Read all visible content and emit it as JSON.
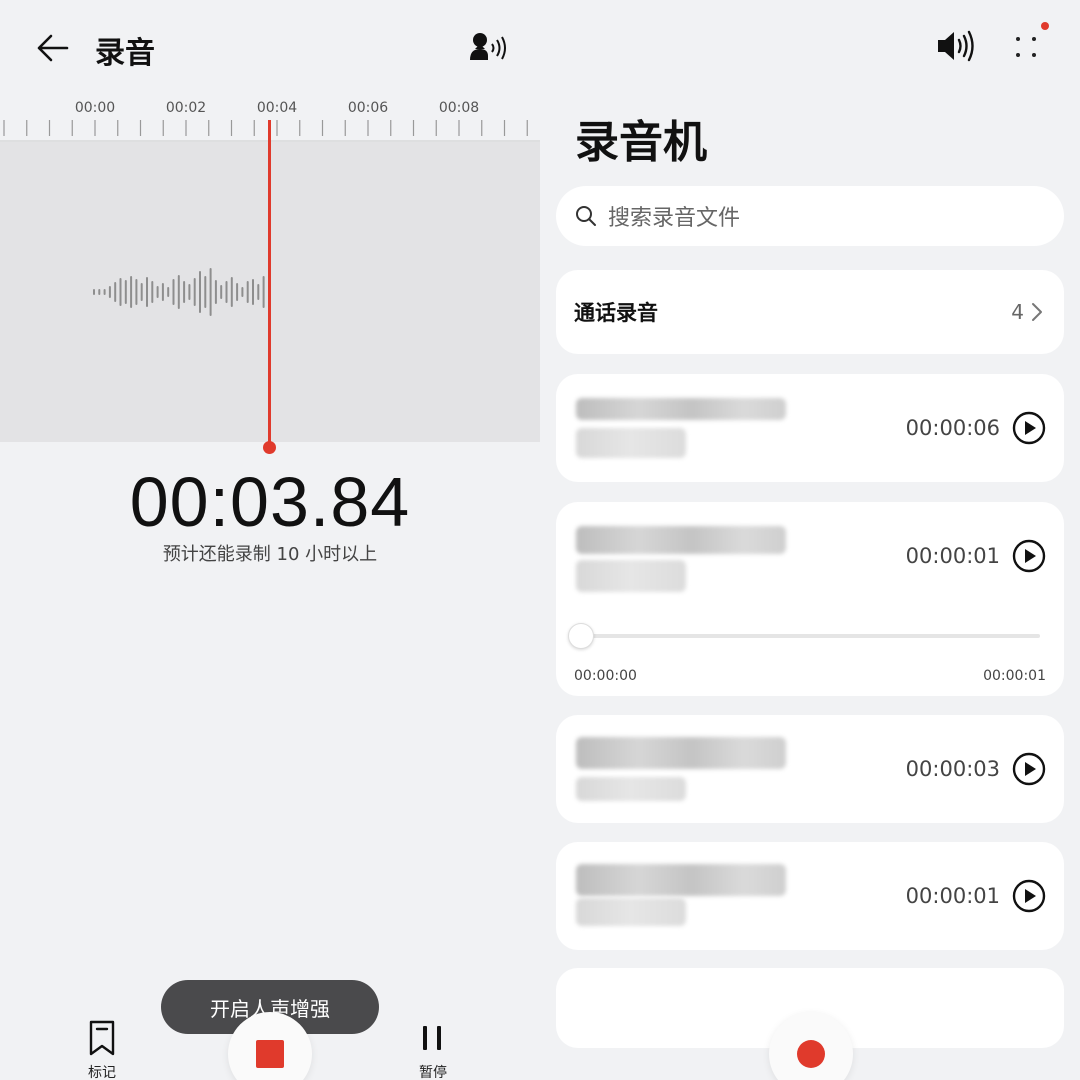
{
  "recorder": {
    "title": "录音",
    "ruler_labels": [
      "00:00",
      "00:02",
      "00:04",
      "00:06",
      "00:08"
    ],
    "timer": "00:03.84",
    "remaining": "预计还能录制 10 小时以上",
    "toast": "开启人声增强",
    "mark_label": "标记",
    "pause_label": "暂停",
    "accent": "#e03a2c",
    "icons": {
      "back": "arrow-left-icon",
      "voice": "voice-enhance-icon",
      "mark": "bookmark-icon",
      "stop": "stop-icon",
      "pause": "pause-icon"
    }
  },
  "library": {
    "title": "录音机",
    "search_placeholder": "搜索录音文件",
    "call_recordings": {
      "label": "通话录音",
      "count": "4"
    },
    "recordings": [
      {
        "duration": "00:00:06"
      },
      {
        "duration": "00:00:01",
        "expanded": true,
        "position": "00:00:00",
        "total": "00:00:01"
      },
      {
        "duration": "00:00:03"
      },
      {
        "duration": "00:00:01"
      }
    ],
    "icons": {
      "speaker": "speaker-icon",
      "more": "more-dots-icon",
      "search": "search-icon",
      "play": "play-icon",
      "record": "record-icon"
    }
  }
}
